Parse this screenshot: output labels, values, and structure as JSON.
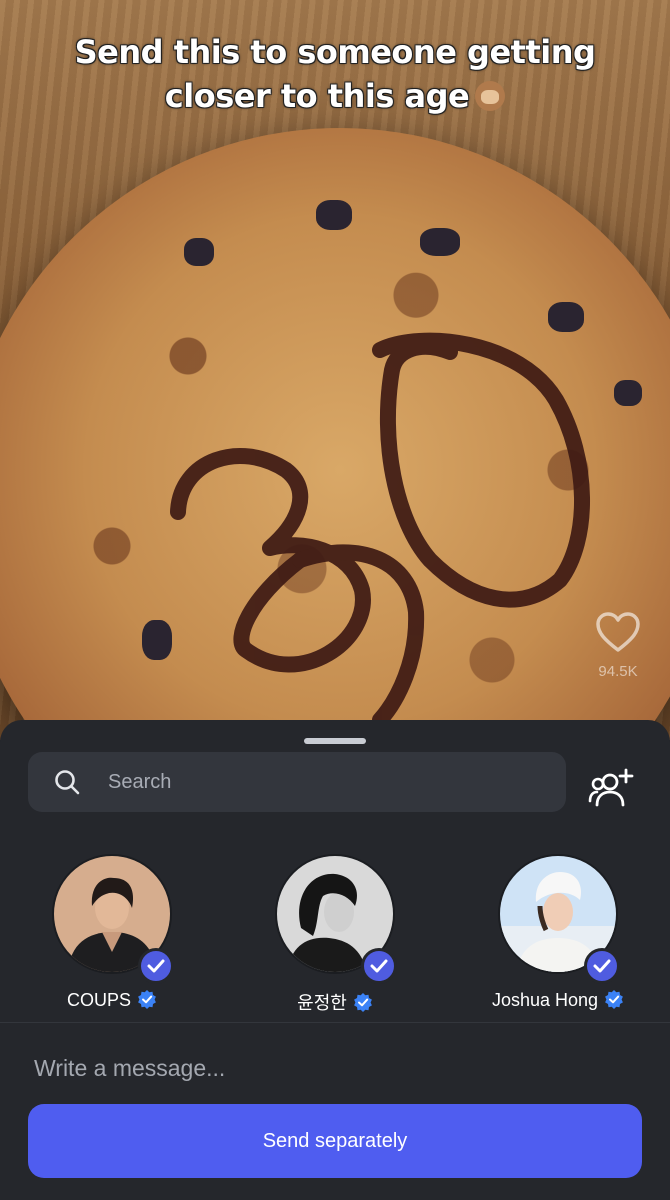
{
  "video": {
    "caption_line1": "Send this to someone getting",
    "caption_line2": "closer to this age",
    "caption_emoji": "see-no-evil-monkey-emoji",
    "like_count": "94.5K"
  },
  "share_sheet": {
    "search_placeholder": "Search",
    "contacts": [
      {
        "name": "COUPS",
        "selected": true,
        "verified": true
      },
      {
        "name": "윤정한",
        "selected": true,
        "verified": true
      },
      {
        "name": "Joshua Hong",
        "selected": true,
        "verified": true
      }
    ],
    "message_placeholder": "Write a message...",
    "send_label": "Send separately"
  },
  "colors": {
    "sheet_bg": "#25272c",
    "field_bg": "#33363d",
    "accent": "#4f5df0",
    "verified_blue": "#3b82f6"
  }
}
